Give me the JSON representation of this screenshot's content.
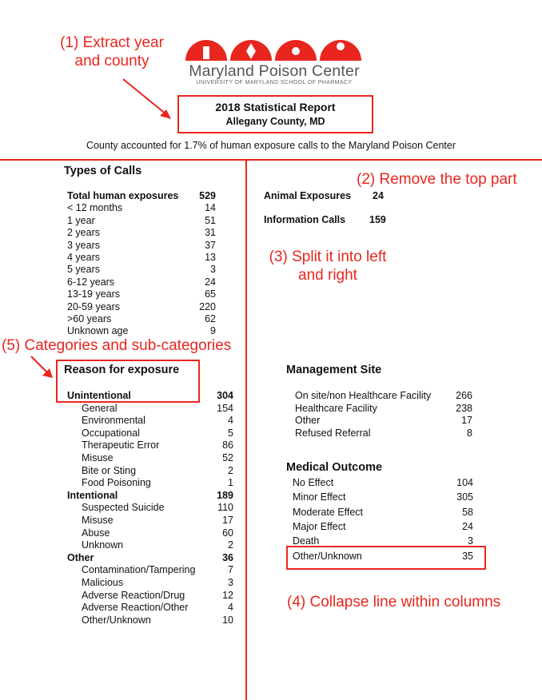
{
  "logo": {
    "name": "Maryland Poison Center",
    "subtitle": "UNIVERSITY OF MARYLAND SCHOOL OF PHARMACY",
    "color": "#e8261e"
  },
  "report": {
    "title": "2018 Statistical Report",
    "county": "Allegany County, MD"
  },
  "summary": "County accounted for 1.7% of human exposure calls to the Maryland Poison Center",
  "annotations": {
    "a1_line1": "(1) Extract year",
    "a1_line2": "and county",
    "a2": "(2) Remove the top part",
    "a3_line1": "(3) Split it into left",
    "a3_line2": "and right",
    "a4": "(4) Collapse line within columns",
    "a5": "(5) Categories and sub-categories"
  },
  "types_of_calls": {
    "heading": "Types of Calls",
    "rows": [
      {
        "label": "Total human exposures",
        "value": "529",
        "bold": true
      },
      {
        "label": "< 12 months",
        "value": "14"
      },
      {
        "label": "1 year",
        "value": "51"
      },
      {
        "label": "2 years",
        "value": "31"
      },
      {
        "label": "3 years",
        "value": "37"
      },
      {
        "label": "4 years",
        "value": "13"
      },
      {
        "label": "5 years",
        "value": "3"
      },
      {
        "label": "6-12 years",
        "value": "24"
      },
      {
        "label": "13-19 years",
        "value": "65"
      },
      {
        "label": "20-59 years",
        "value": "220"
      },
      {
        "label": ">60 years",
        "value": "62"
      },
      {
        "label": "Unknown age",
        "value": "9"
      }
    ],
    "animal": {
      "label": "Animal Exposures",
      "value": "24"
    },
    "info": {
      "label": "Information Calls",
      "value": "159"
    }
  },
  "reason": {
    "heading": "Reason for exposure",
    "rows": [
      {
        "label": "Unintentional",
        "value": "304",
        "bold": true
      },
      {
        "label": "General",
        "value": "154"
      },
      {
        "label": "Environmental",
        "value": "4"
      },
      {
        "label": "Occupational",
        "value": "5"
      },
      {
        "label": "Therapeutic Error",
        "value": "86"
      },
      {
        "label": "Misuse",
        "value": "52"
      },
      {
        "label": "Bite or Sting",
        "value": "2"
      },
      {
        "label": "Food Poisoning",
        "value": "1"
      },
      {
        "label": "Intentional",
        "value": "189",
        "bold": true
      },
      {
        "label": "Suspected Suicide",
        "value": "110"
      },
      {
        "label": "Misuse",
        "value": "17"
      },
      {
        "label": "Abuse",
        "value": "60"
      },
      {
        "label": "Unknown",
        "value": "2"
      },
      {
        "label": "Other",
        "value": "36",
        "bold": true
      },
      {
        "label": "Contamination/Tampering",
        "value": "7"
      },
      {
        "label": "Malicious",
        "value": "3"
      },
      {
        "label": "Adverse Reaction/Drug",
        "value": "12"
      },
      {
        "label": "Adverse Reaction/Other",
        "value": "4"
      },
      {
        "label": "Other/Unknown",
        "value": "10"
      }
    ]
  },
  "management": {
    "heading": "Management Site",
    "rows": [
      {
        "label": "On site/non Healthcare Facility",
        "value": "266"
      },
      {
        "label": "Healthcare Facility",
        "value": "238"
      },
      {
        "label": "Other",
        "value": "17"
      },
      {
        "label": "Refused Referral",
        "value": "8"
      }
    ]
  },
  "outcome": {
    "heading": "Medical Outcome",
    "rows": [
      {
        "label": "No Effect",
        "value": "104"
      },
      {
        "label": "Minor Effect",
        "value": "305"
      },
      {
        "label": "Moderate Effect",
        "value": "58"
      },
      {
        "label": "Major Effect",
        "value": "24"
      },
      {
        "label": "Death",
        "value": "3"
      },
      {
        "label": "Other/Unknown",
        "value": "35"
      }
    ]
  }
}
